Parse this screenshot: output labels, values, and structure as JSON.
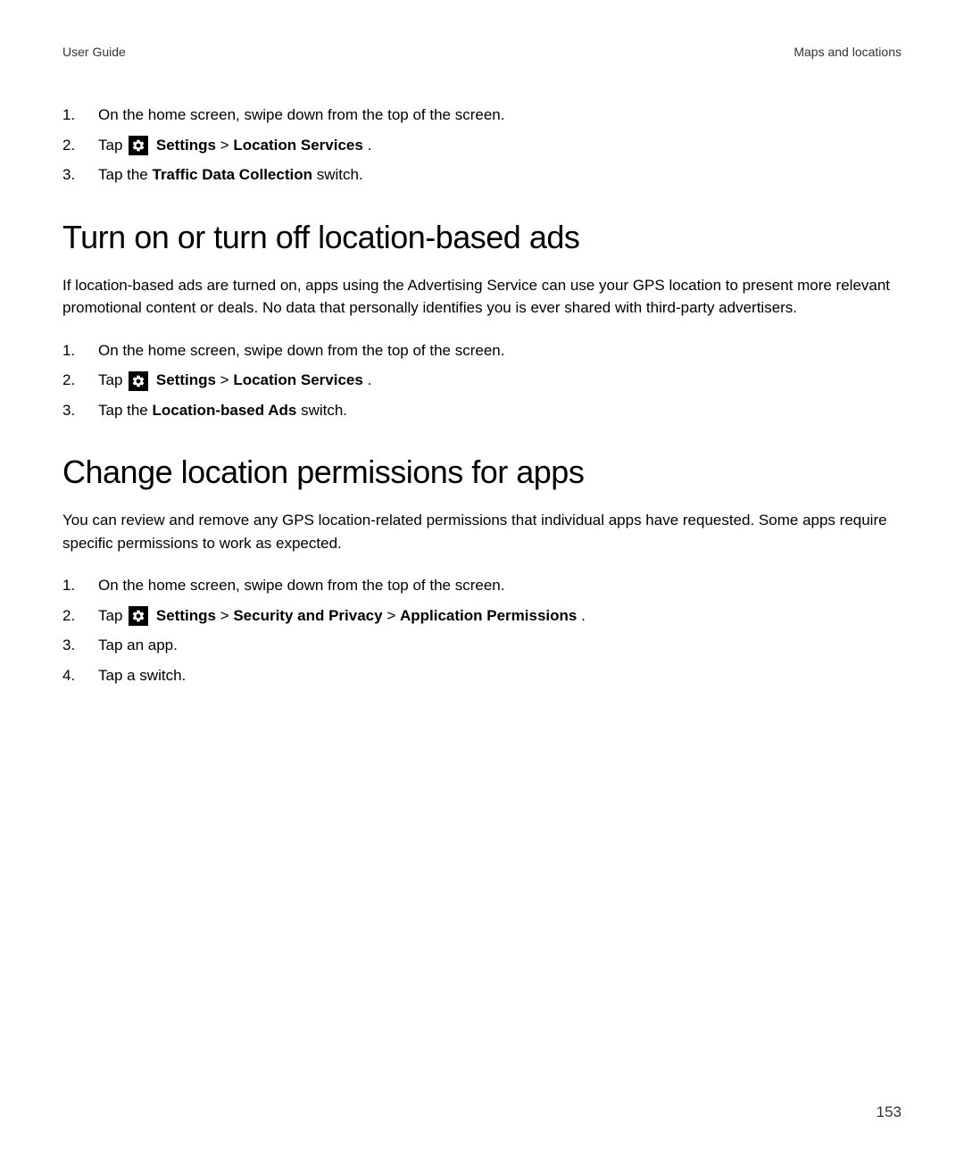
{
  "header": {
    "left": "User Guide",
    "right": "Maps and locations"
  },
  "topSteps": {
    "items": [
      {
        "num": "1.",
        "text": "On the home screen, swipe down from the top of the screen."
      },
      {
        "num": "2.",
        "tap": "Tap ",
        "settings": "Settings",
        "sep": " > ",
        "loc": "Location Services",
        "end": "."
      },
      {
        "num": "3.",
        "pre": "Tap the ",
        "bold": "Traffic Data Collection",
        "post": " switch."
      }
    ]
  },
  "section1": {
    "title": "Turn on or turn off location-based ads",
    "intro": "If location-based ads are turned on, apps using the Advertising Service can use your GPS location to present more relevant promotional content or deals. No data that personally identifies you is ever shared with third-party advertisers.",
    "items": [
      {
        "num": "1.",
        "text": "On the home screen, swipe down from the top of the screen."
      },
      {
        "num": "2.",
        "tap": "Tap ",
        "settings": "Settings",
        "sep": " > ",
        "loc": "Location Services",
        "end": "."
      },
      {
        "num": "3.",
        "pre": "Tap the ",
        "bold": "Location-based Ads",
        "post": " switch."
      }
    ]
  },
  "section2": {
    "title": "Change location permissions for apps",
    "intro": "You can review and remove any GPS location-related permissions that individual apps have requested. Some apps require specific permissions to work as expected.",
    "items": [
      {
        "num": "1.",
        "text": "On the home screen, swipe down from the top of the screen."
      },
      {
        "num": "2.",
        "tap": "Tap ",
        "settings": "Settings",
        "sep1": " > ",
        "sec": "Security and Privacy",
        "sep2": " > ",
        "app": "Application Permissions",
        "end": "."
      },
      {
        "num": "3.",
        "text": "Tap an app."
      },
      {
        "num": "4.",
        "text": "Tap a switch."
      }
    ]
  },
  "pageNumber": "153"
}
